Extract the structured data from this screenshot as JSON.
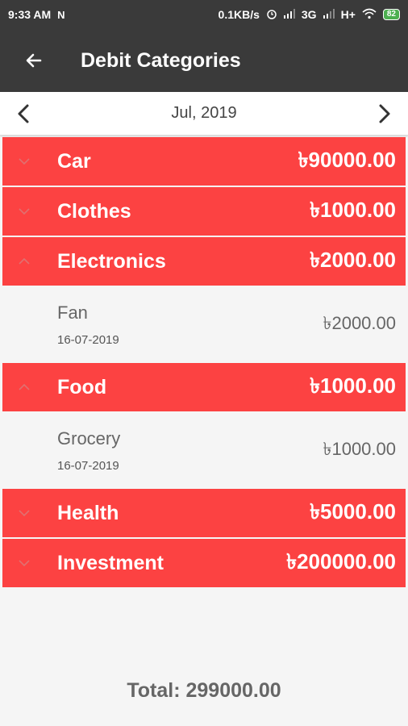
{
  "status_bar": {
    "time": "9:33 AM",
    "net_speed": "0.1KB/s",
    "network_3g": "3G",
    "network_hplus": "H+",
    "battery": "82"
  },
  "app_bar": {
    "title": "Debit Categories",
    "back_icon": "arrow-left-icon"
  },
  "month_nav": {
    "label": "Jul, 2019",
    "prev_icon": "chevron-left-icon",
    "next_icon": "chevron-right-icon"
  },
  "categories": [
    {
      "name": "Car",
      "amount": "৳90000.00",
      "expanded": false
    },
    {
      "name": "Clothes",
      "amount": "৳1000.00",
      "expanded": false
    },
    {
      "name": "Electronics",
      "amount": "৳2000.00",
      "expanded": true,
      "items": [
        {
          "name": "Fan",
          "date": "16-07-2019",
          "amount": "৳2000.00"
        }
      ]
    },
    {
      "name": "Food",
      "amount": "৳1000.00",
      "expanded": true,
      "items": [
        {
          "name": "Grocery",
          "date": "16-07-2019",
          "amount": "৳1000.00"
        }
      ]
    },
    {
      "name": "Health",
      "amount": "৳5000.00",
      "expanded": false
    },
    {
      "name": "Investment",
      "amount": "৳200000.00",
      "expanded": false
    }
  ],
  "total": "Total: 299000.00",
  "colors": {
    "header": "#3a3a3a",
    "category": "#fc4242",
    "background": "#f5f5f5"
  }
}
